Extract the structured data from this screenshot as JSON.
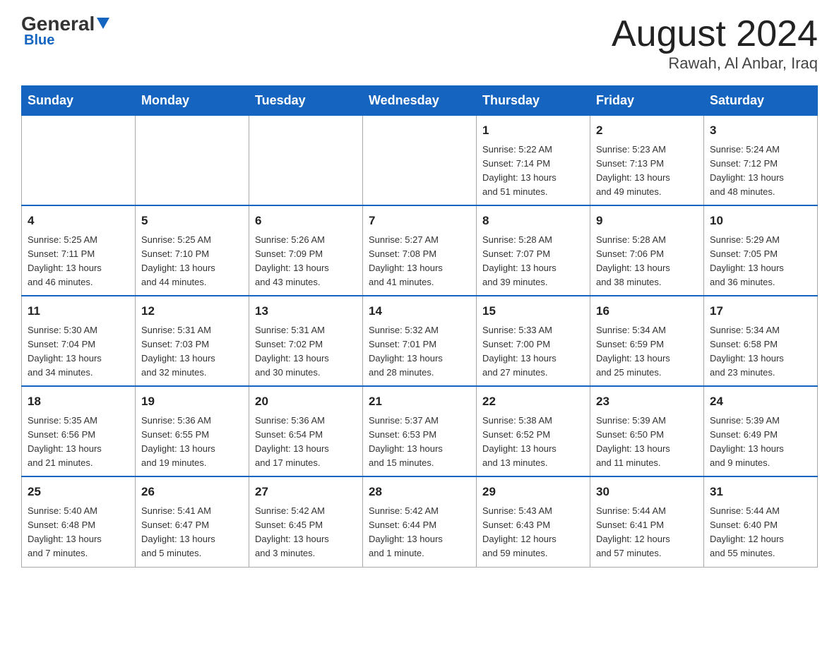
{
  "header": {
    "logo_general": "General",
    "logo_blue": "Blue",
    "month_title": "August 2024",
    "subtitle": "Rawah, Al Anbar, Iraq"
  },
  "days_of_week": [
    "Sunday",
    "Monday",
    "Tuesday",
    "Wednesday",
    "Thursday",
    "Friday",
    "Saturday"
  ],
  "weeks": [
    [
      {
        "day": "",
        "info": ""
      },
      {
        "day": "",
        "info": ""
      },
      {
        "day": "",
        "info": ""
      },
      {
        "day": "",
        "info": ""
      },
      {
        "day": "1",
        "info": "Sunrise: 5:22 AM\nSunset: 7:14 PM\nDaylight: 13 hours\nand 51 minutes."
      },
      {
        "day": "2",
        "info": "Sunrise: 5:23 AM\nSunset: 7:13 PM\nDaylight: 13 hours\nand 49 minutes."
      },
      {
        "day": "3",
        "info": "Sunrise: 5:24 AM\nSunset: 7:12 PM\nDaylight: 13 hours\nand 48 minutes."
      }
    ],
    [
      {
        "day": "4",
        "info": "Sunrise: 5:25 AM\nSunset: 7:11 PM\nDaylight: 13 hours\nand 46 minutes."
      },
      {
        "day": "5",
        "info": "Sunrise: 5:25 AM\nSunset: 7:10 PM\nDaylight: 13 hours\nand 44 minutes."
      },
      {
        "day": "6",
        "info": "Sunrise: 5:26 AM\nSunset: 7:09 PM\nDaylight: 13 hours\nand 43 minutes."
      },
      {
        "day": "7",
        "info": "Sunrise: 5:27 AM\nSunset: 7:08 PM\nDaylight: 13 hours\nand 41 minutes."
      },
      {
        "day": "8",
        "info": "Sunrise: 5:28 AM\nSunset: 7:07 PM\nDaylight: 13 hours\nand 39 minutes."
      },
      {
        "day": "9",
        "info": "Sunrise: 5:28 AM\nSunset: 7:06 PM\nDaylight: 13 hours\nand 38 minutes."
      },
      {
        "day": "10",
        "info": "Sunrise: 5:29 AM\nSunset: 7:05 PM\nDaylight: 13 hours\nand 36 minutes."
      }
    ],
    [
      {
        "day": "11",
        "info": "Sunrise: 5:30 AM\nSunset: 7:04 PM\nDaylight: 13 hours\nand 34 minutes."
      },
      {
        "day": "12",
        "info": "Sunrise: 5:31 AM\nSunset: 7:03 PM\nDaylight: 13 hours\nand 32 minutes."
      },
      {
        "day": "13",
        "info": "Sunrise: 5:31 AM\nSunset: 7:02 PM\nDaylight: 13 hours\nand 30 minutes."
      },
      {
        "day": "14",
        "info": "Sunrise: 5:32 AM\nSunset: 7:01 PM\nDaylight: 13 hours\nand 28 minutes."
      },
      {
        "day": "15",
        "info": "Sunrise: 5:33 AM\nSunset: 7:00 PM\nDaylight: 13 hours\nand 27 minutes."
      },
      {
        "day": "16",
        "info": "Sunrise: 5:34 AM\nSunset: 6:59 PM\nDaylight: 13 hours\nand 25 minutes."
      },
      {
        "day": "17",
        "info": "Sunrise: 5:34 AM\nSunset: 6:58 PM\nDaylight: 13 hours\nand 23 minutes."
      }
    ],
    [
      {
        "day": "18",
        "info": "Sunrise: 5:35 AM\nSunset: 6:56 PM\nDaylight: 13 hours\nand 21 minutes."
      },
      {
        "day": "19",
        "info": "Sunrise: 5:36 AM\nSunset: 6:55 PM\nDaylight: 13 hours\nand 19 minutes."
      },
      {
        "day": "20",
        "info": "Sunrise: 5:36 AM\nSunset: 6:54 PM\nDaylight: 13 hours\nand 17 minutes."
      },
      {
        "day": "21",
        "info": "Sunrise: 5:37 AM\nSunset: 6:53 PM\nDaylight: 13 hours\nand 15 minutes."
      },
      {
        "day": "22",
        "info": "Sunrise: 5:38 AM\nSunset: 6:52 PM\nDaylight: 13 hours\nand 13 minutes."
      },
      {
        "day": "23",
        "info": "Sunrise: 5:39 AM\nSunset: 6:50 PM\nDaylight: 13 hours\nand 11 minutes."
      },
      {
        "day": "24",
        "info": "Sunrise: 5:39 AM\nSunset: 6:49 PM\nDaylight: 13 hours\nand 9 minutes."
      }
    ],
    [
      {
        "day": "25",
        "info": "Sunrise: 5:40 AM\nSunset: 6:48 PM\nDaylight: 13 hours\nand 7 minutes."
      },
      {
        "day": "26",
        "info": "Sunrise: 5:41 AM\nSunset: 6:47 PM\nDaylight: 13 hours\nand 5 minutes."
      },
      {
        "day": "27",
        "info": "Sunrise: 5:42 AM\nSunset: 6:45 PM\nDaylight: 13 hours\nand 3 minutes."
      },
      {
        "day": "28",
        "info": "Sunrise: 5:42 AM\nSunset: 6:44 PM\nDaylight: 13 hours\nand 1 minute."
      },
      {
        "day": "29",
        "info": "Sunrise: 5:43 AM\nSunset: 6:43 PM\nDaylight: 12 hours\nand 59 minutes."
      },
      {
        "day": "30",
        "info": "Sunrise: 5:44 AM\nSunset: 6:41 PM\nDaylight: 12 hours\nand 57 minutes."
      },
      {
        "day": "31",
        "info": "Sunrise: 5:44 AM\nSunset: 6:40 PM\nDaylight: 12 hours\nand 55 minutes."
      }
    ]
  ]
}
